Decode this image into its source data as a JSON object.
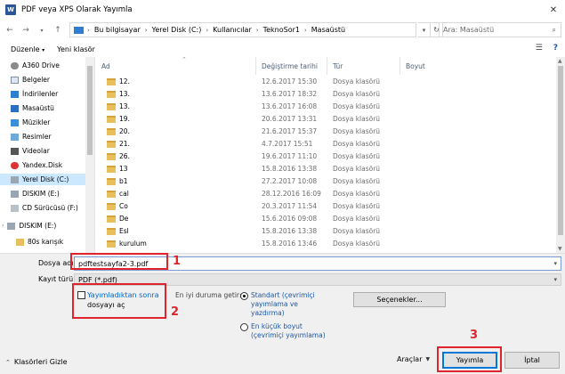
{
  "window": {
    "title": "PDF veya XPS Olarak Yayımla",
    "app_icon": "word-icon"
  },
  "address": {
    "breadcrumbs": [
      "Bu bilgisayar",
      "Yerel Disk (C:)",
      "Kullanıcılar",
      "TeknoSor1",
      "Masaüstü"
    ],
    "search_placeholder": "Ara: Masaüstü"
  },
  "toolbar": {
    "organize": "Düzenle",
    "new_folder": "Yeni klasör"
  },
  "sidebar": {
    "items": [
      {
        "label": "A360 Drive",
        "icon": "cloud-icon"
      },
      {
        "label": "Belgeler",
        "icon": "documents-icon"
      },
      {
        "label": "İndirilenler",
        "icon": "downloads-icon"
      },
      {
        "label": "Masaüstü",
        "icon": "desktop-icon"
      },
      {
        "label": "Müzikler",
        "icon": "music-icon"
      },
      {
        "label": "Resimler",
        "icon": "pictures-icon"
      },
      {
        "label": "Videolar",
        "icon": "videos-icon"
      },
      {
        "label": "Yandex.Disk",
        "icon": "yandex-disk-icon"
      },
      {
        "label": "Yerel Disk (C:)",
        "icon": "drive-icon"
      },
      {
        "label": "DISKIM (E:)",
        "icon": "drive-icon"
      },
      {
        "label": "CD Sürücüsü (F:)",
        "icon": "cd-drive-icon"
      },
      {
        "label": "DISKIM (E:)",
        "icon": "drive-icon"
      },
      {
        "label": "80s karışık",
        "icon": "folder-icon"
      }
    ]
  },
  "filelist": {
    "columns": [
      "Ad",
      "Değiştirme tarihi",
      "Tür",
      "Boyut"
    ],
    "rows": [
      {
        "name": "12.",
        "date": "12.6.2017 15:30",
        "type": "Dosya klasörü"
      },
      {
        "name": "13.",
        "date": "13.6.2017 18:32",
        "type": "Dosya klasörü"
      },
      {
        "name": "13.",
        "date": "13.6.2017 16:08",
        "type": "Dosya klasörü"
      },
      {
        "name": "19.",
        "date": "20.6.2017 13:31",
        "type": "Dosya klasörü"
      },
      {
        "name": "20.",
        "date": "21.6.2017 15:37",
        "type": "Dosya klasörü"
      },
      {
        "name": "21.",
        "date": "4.7.2017 15:51",
        "type": "Dosya klasörü"
      },
      {
        "name": "26.",
        "date": "19.6.2017 11:10",
        "type": "Dosya klasörü"
      },
      {
        "name": "13",
        "date": "15.8.2016 13:38",
        "type": "Dosya klasörü"
      },
      {
        "name": "b1",
        "date": "27.2.2017 10:08",
        "type": "Dosya klasörü"
      },
      {
        "name": "cal",
        "date": "28.12.2016 16:09",
        "type": "Dosya klasörü"
      },
      {
        "name": "Co",
        "date": "20.3.2017 11:54",
        "type": "Dosya klasörü"
      },
      {
        "name": "De",
        "date": "15.6.2016 09:08",
        "type": "Dosya klasörü"
      },
      {
        "name": "Esl",
        "date": "15.8.2016 13:38",
        "type": "Dosya klasörü"
      },
      {
        "name": "kurulum",
        "date": "15.8.2016 13:46",
        "type": "Dosya klasörü"
      }
    ]
  },
  "form": {
    "filename_label": "Dosya adı:",
    "filename_value": "pdftestsayfa2-3.pdf",
    "filetype_label": "Kayıt türü:",
    "filetype_value": "PDF (*.pdf)",
    "open_after_line1": "Yayımladıktan sonra",
    "open_after_line2": "dosyayı aç",
    "optimize_label": "En iyi duruma getir:",
    "radio_standard_1": "Standart (çevrimiçi",
    "radio_standard_2": "yayımlama ve",
    "radio_standard_3": "yazdırma)",
    "radio_min_1": "En küçük boyut",
    "radio_min_2": "(çevrimiçi yayımlama)",
    "options_button": "Seçenekler...",
    "hide_folders": "Klasörleri Gizle",
    "tools": "Araçlar",
    "publish_button": "Yayımla",
    "cancel_button": "İptal"
  },
  "annotations": {
    "n1": "1",
    "n2": "2",
    "n3": "3",
    "color": "#e0242d"
  }
}
